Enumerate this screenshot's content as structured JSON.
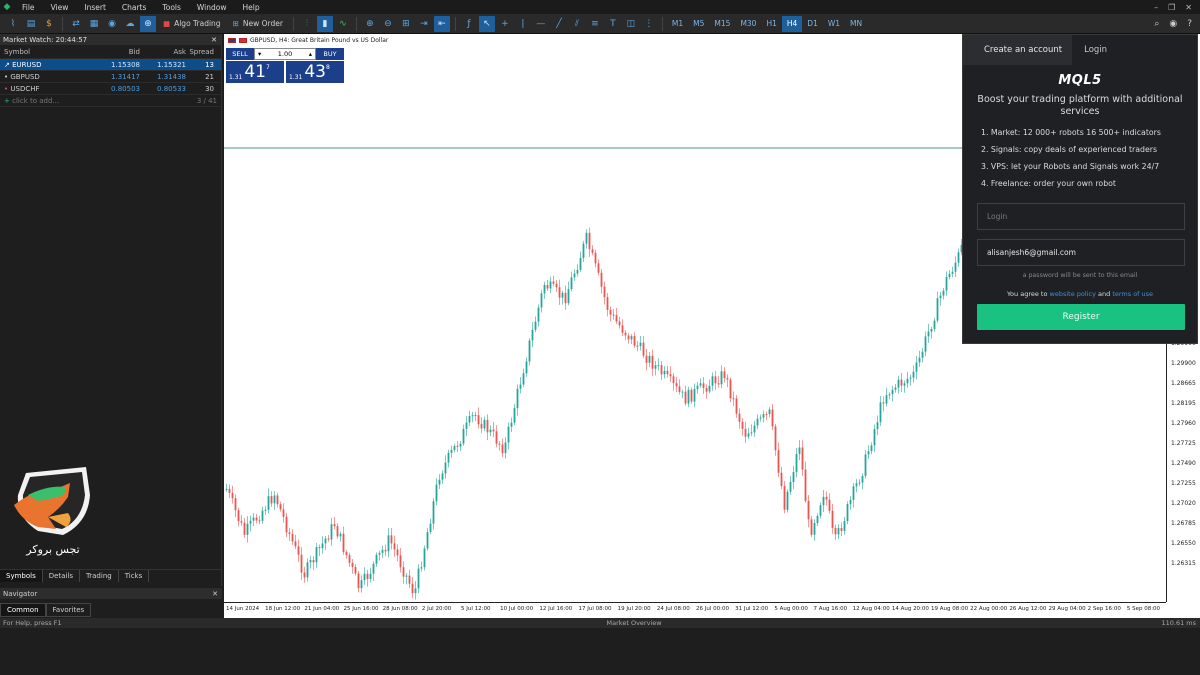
{
  "menu": {
    "items": [
      "File",
      "View",
      "Insert",
      "Charts",
      "Tools",
      "Window",
      "Help"
    ],
    "window_controls": [
      "–",
      "❐",
      "✕"
    ]
  },
  "toolbar": {
    "algo_trading": "Algo Trading",
    "new_order": "New Order",
    "timeframes": [
      "M1",
      "M5",
      "M15",
      "M30",
      "H1",
      "H4",
      "D1",
      "W1",
      "MN"
    ],
    "active_timeframe": "H4"
  },
  "market_watch": {
    "title": "Market Watch: 20:44:57",
    "close": "✕",
    "columns": {
      "symbol": "Symbol",
      "bid": "Bid",
      "ask": "Ask",
      "spread": "Spread"
    },
    "rows": [
      {
        "symbol": "EURUSD",
        "bid": "1.15308",
        "ask": "1.15321",
        "spread": "13",
        "arrow": "↗"
      },
      {
        "symbol": "GBPUSD",
        "bid": "1.31417",
        "ask": "1.31438",
        "spread": "21",
        "arrow": "•"
      },
      {
        "symbol": "USDCHF",
        "bid": "0.80503",
        "ask": "0.80533",
        "spread": "30",
        "arrow": "•"
      }
    ],
    "add_label": "click to add...",
    "count": "3 / 41",
    "tabs": [
      "Symbols",
      "Details",
      "Trading",
      "Ticks"
    ]
  },
  "navigator": {
    "title": "Navigator",
    "close": "✕",
    "tabs": [
      "Common",
      "Favorites"
    ]
  },
  "logo": {
    "text": "تجس بروكر"
  },
  "chart": {
    "title": "GBPUSD, H4:  Great Britain Pound vs US Dollar",
    "one_click": {
      "sell_label": "SELL",
      "buy_label": "BUY",
      "lot": "1.00",
      "sell_small": "1.31",
      "sell_big": "41",
      "sell_sup": "7",
      "buy_small": "1.31",
      "buy_big": "43",
      "buy_sup": "8"
    },
    "y_ticks": [
      "1.29900",
      "1.29900",
      "1.28665",
      "1.28195",
      "1.27960",
      "1.27725",
      "1.27490",
      "1.27255",
      "1.27020",
      "1.26785",
      "1.26550",
      "1.26315"
    ],
    "x_ticks": [
      "14 Jun 2024",
      "18 Jun 12:00",
      "21 Jun 04:00",
      "25 Jun 16:00",
      "28 Jun 08:00",
      "2 Jul 20:00",
      "5 Jul 12:00",
      "10 Jul 00:00",
      "12 Jul 16:00",
      "17 Jul 08:00",
      "19 Jul 20:00",
      "24 Jul 08:00",
      "26 Jul 00:00",
      "31 Jul 12:00",
      "5 Aug 00:00",
      "7 Aug 16:00",
      "12 Aug 04:00",
      "14 Aug 20:00",
      "19 Aug 08:00",
      "22 Aug 00:00",
      "26 Aug 12:00",
      "29 Aug 04:00",
      "2 Sep 16:00",
      "5 Sep 08:00"
    ],
    "colors": {
      "up": "#26a69a",
      "down": "#ef5350",
      "hline": "#4e9a7a"
    }
  },
  "panel": {
    "tabs": [
      "Create an account",
      "Login"
    ],
    "logo": "MQL5",
    "headline": "Boost your trading platform with additional services",
    "list": [
      "1. Market: 12 000+ robots 16 500+ indicators",
      "2. Signals: copy deals of experienced traders",
      "3. VPS: let your Robots and Signals work 24/7",
      "4. Freelance: order your own robot"
    ],
    "login_placeholder": "Login",
    "email_value": "alisanjesh6@gmail.com",
    "password_note": "a password will be sent to this email",
    "agree_prefix": "You agree to",
    "website_policy": "website policy",
    "and": "and",
    "terms": "terms of use",
    "register": "Register"
  },
  "status": {
    "left": "For Help, press F1",
    "mid": "Market Overview",
    "right": "110.61 ms"
  }
}
